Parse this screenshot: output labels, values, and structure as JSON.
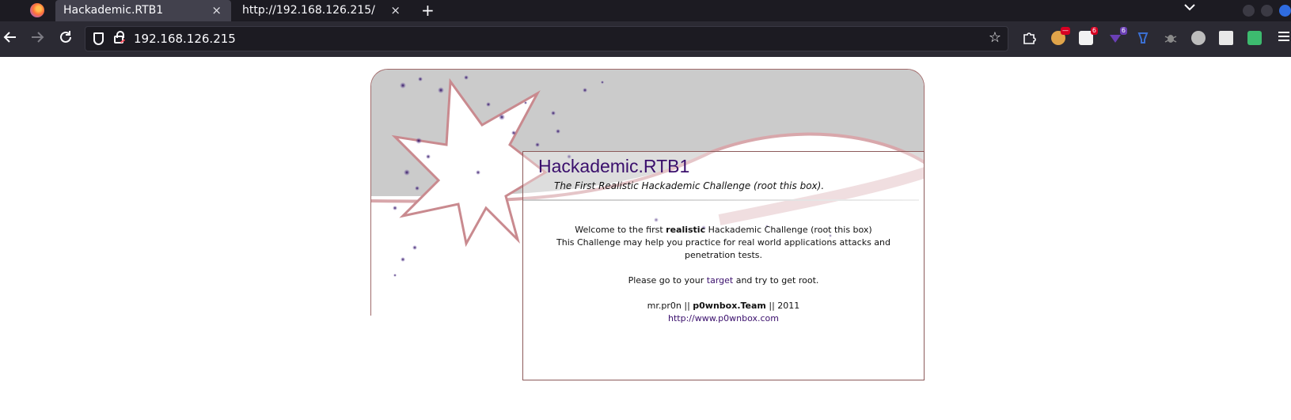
{
  "browser": {
    "tabs": [
      {
        "title": "Hackademic.RTB1",
        "active": true
      },
      {
        "title": "http://192.168.126.215/",
        "active": false
      }
    ],
    "url": "192.168.126.215",
    "new_tab_symbol": "+",
    "close_symbol": "×",
    "extensions": [
      {
        "name": "cookie-extension-icon",
        "color": "#e0a44a",
        "badge": ""
      },
      {
        "name": "mail-extension-icon",
        "color": "#f2f2f2",
        "badge": "6",
        "badge_color": "#d70022"
      },
      {
        "name": "download-extension-icon",
        "color": "#6a3fb5",
        "badge": "6",
        "badge_color": "#6a3fb5"
      },
      {
        "name": "wappalyzer-extension-icon",
        "color": "#3b6fd1",
        "badge": ""
      },
      {
        "name": "bug-extension-icon",
        "color": "#8a8a8a",
        "badge": ""
      },
      {
        "name": "globe-extension-icon",
        "color": "#bdbdbd",
        "badge": ""
      },
      {
        "name": "folder-extension-icon",
        "color": "#e8e8e8",
        "badge": ""
      },
      {
        "name": "devtools-extension-icon",
        "color": "#3dbb6f",
        "badge": ""
      }
    ]
  },
  "site": {
    "title": "Hackademic.RTB1",
    "subtitle": "The First Realistic Hackademic Challenge (root this box).",
    "welcome_before": "Welcome to the first ",
    "welcome_bold": "realistic",
    "welcome_after": " Hackademic Challenge (root this box)",
    "challenge_text": "This Challenge may help you practice for real world applications attacks and penetration tests.",
    "goto_before": "Please go to your ",
    "goto_link": "target",
    "goto_after": " and try to get root.",
    "credit_before": "mr.pr0n || ",
    "credit_team": "p0wnbox.Team",
    "credit_after": " || 2011",
    "homepage_link": "http://www.p0wnbox.com"
  },
  "colors": {
    "accent_purple": "#3a0f6c",
    "border_brown": "#8c5a5a",
    "header_gray": "#cbcbcb",
    "ribbon_pink": "#c98a8f"
  }
}
